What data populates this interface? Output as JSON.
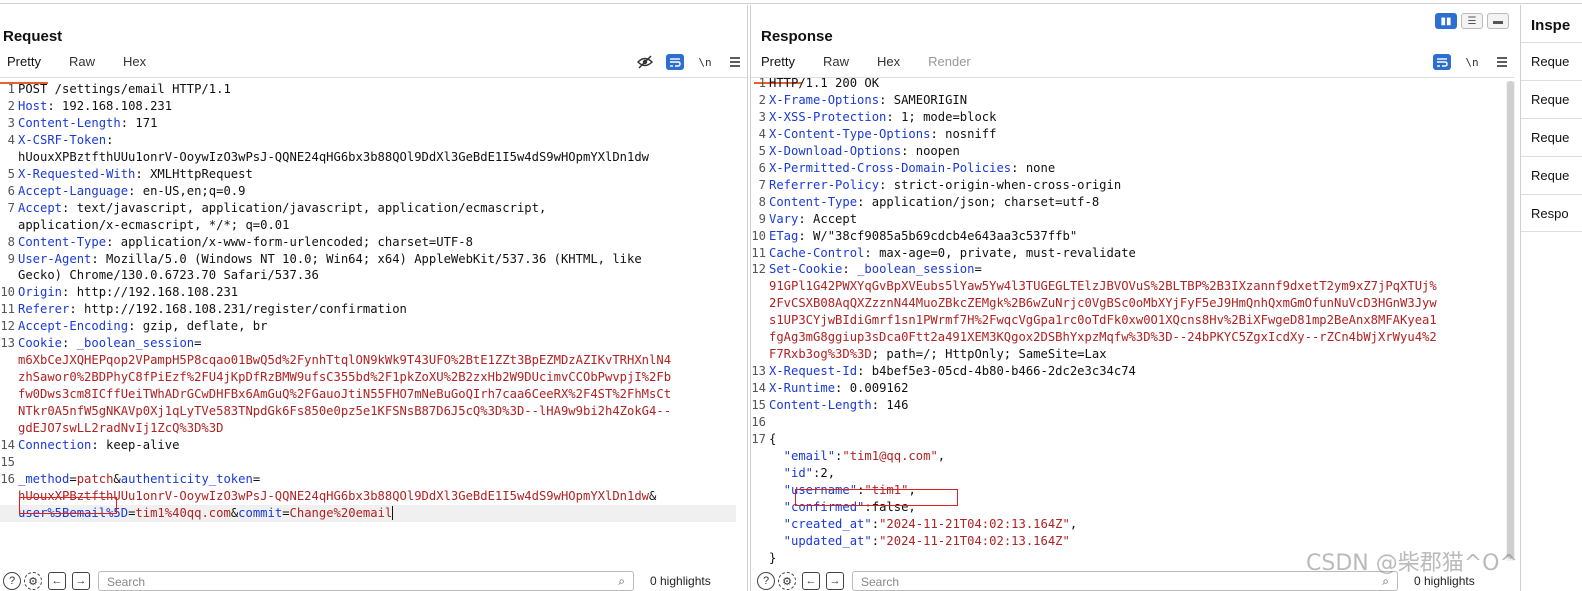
{
  "request": {
    "title": "Request",
    "tabs": [
      "Pretty",
      "Raw",
      "Hex"
    ],
    "lines": [
      {
        "n": "1",
        "parts": [
          {
            "t": "POST /settings/email HTTP/1.1",
            "c": "v"
          }
        ]
      },
      {
        "n": "2",
        "parts": [
          {
            "t": "Host",
            "c": "k"
          },
          {
            "t": ": 192.168.108.231",
            "c": "v"
          }
        ]
      },
      {
        "n": "3",
        "parts": [
          {
            "t": "Content-Length",
            "c": "k"
          },
          {
            "t": ": 171",
            "c": "v"
          }
        ]
      },
      {
        "n": "4",
        "parts": [
          {
            "t": "X-CSRF-Token",
            "c": "k"
          },
          {
            "t": ":",
            "c": "v"
          }
        ]
      },
      {
        "n": "",
        "parts": [
          {
            "t": "hUouxXPBztfthUUu1onrV-OoywIzO3wPsJ-QQNE24qHG6bx3b88QOl9DdXl3GeBdE1I5w4dS9wHOpmYXlDn1dw",
            "c": "v"
          }
        ]
      },
      {
        "n": "5",
        "parts": [
          {
            "t": "X-Requested-With",
            "c": "k"
          },
          {
            "t": ": XMLHttpRequest",
            "c": "v"
          }
        ]
      },
      {
        "n": "6",
        "parts": [
          {
            "t": "Accept-Language",
            "c": "k"
          },
          {
            "t": ": en-US,en;q=0.9",
            "c": "v"
          }
        ]
      },
      {
        "n": "7",
        "parts": [
          {
            "t": "Accept",
            "c": "k"
          },
          {
            "t": ": text/javascript, application/javascript, application/ecmascript,",
            "c": "v"
          }
        ]
      },
      {
        "n": "",
        "parts": [
          {
            "t": "application/x-ecmascript, */*; q=0.01",
            "c": "v"
          }
        ]
      },
      {
        "n": "8",
        "parts": [
          {
            "t": "Content-Type",
            "c": "k"
          },
          {
            "t": ": application/x-www-form-urlencoded; charset=UTF-8",
            "c": "v"
          }
        ]
      },
      {
        "n": "9",
        "parts": [
          {
            "t": "User-Agent",
            "c": "k"
          },
          {
            "t": ": Mozilla/5.0 (Windows NT 10.0; Win64; x64) AppleWebKit/537.36 (KHTML, like",
            "c": "v"
          }
        ]
      },
      {
        "n": "",
        "parts": [
          {
            "t": "Gecko) Chrome/130.0.6723.70 Safari/537.36",
            "c": "v"
          }
        ]
      },
      {
        "n": "10",
        "parts": [
          {
            "t": "Origin",
            "c": "k"
          },
          {
            "t": ": http://192.168.108.231",
            "c": "v"
          }
        ]
      },
      {
        "n": "11",
        "parts": [
          {
            "t": "Referer",
            "c": "k"
          },
          {
            "t": ": http://192.168.108.231/register/confirmation",
            "c": "v"
          }
        ]
      },
      {
        "n": "12",
        "parts": [
          {
            "t": "Accept-Encoding",
            "c": "k"
          },
          {
            "t": ": gzip, deflate, br",
            "c": "v"
          }
        ]
      },
      {
        "n": "13",
        "parts": [
          {
            "t": "Cookie",
            "c": "k"
          },
          {
            "t": ": ",
            "c": "v"
          },
          {
            "t": "_boolean_session",
            "c": "k"
          },
          {
            "t": "=",
            "c": "v"
          }
        ]
      },
      {
        "n": "",
        "parts": [
          {
            "t": "m6XbCeJXQHEPqop2VPampH5P8cqao01BwQ5d%2FynhTtqlON9kWk9T43UFO%2BtE1ZZt3BpEZMDzAZIKvTRHXnlN4",
            "c": "r"
          }
        ]
      },
      {
        "n": "",
        "parts": [
          {
            "t": "zhSawor0%2BDPhyC8fPiEzf%2FU4jKpDfRzBMW9ufsC355bd%2F1pkZoXU%2B2zxHb2W9DUcimvCCObPwvpjI%2Fb",
            "c": "r"
          }
        ]
      },
      {
        "n": "",
        "parts": [
          {
            "t": "fw0Dws3cm8ICffUeiTWhADrGCwDHFBx6AmGuQ%2FGauoJtiN55FHO7mNeBuGoQIrh7caa6CeeRX%2F4ST%2FhMsCt",
            "c": "r"
          }
        ]
      },
      {
        "n": "",
        "parts": [
          {
            "t": "NTkr0A5nfW5gNKAVp0Xj1qLyTVe583TNpdGk6Fs850e0pz5e1KFSNsB87D6J5cQ%3D%3D--lHA9w9bi2h4ZokG4--",
            "c": "r"
          }
        ]
      },
      {
        "n": "",
        "parts": [
          {
            "t": "gdEJO7swLL2radNvIj1ZcQ%3D%3D",
            "c": "r"
          }
        ]
      },
      {
        "n": "14",
        "parts": [
          {
            "t": "Connection",
            "c": "k"
          },
          {
            "t": ": keep-alive",
            "c": "v"
          }
        ]
      },
      {
        "n": "15",
        "parts": [
          {
            "t": "",
            "c": "v"
          }
        ]
      },
      {
        "n": "16",
        "parts": [
          {
            "t": "_method",
            "c": "k"
          },
          {
            "t": "=",
            "c": "v"
          },
          {
            "t": "patch",
            "c": "r"
          },
          {
            "t": "&",
            "c": "v"
          },
          {
            "t": "authenticity_token",
            "c": "k"
          },
          {
            "t": "=",
            "c": "v"
          }
        ]
      },
      {
        "n": "",
        "parts": [
          {
            "t": "hUouxXPBztfthUUu1onrV-OoywIzO3wPsJ-QQNE24qHG6bx3b88QOl9DdXl3GeBdE1I5w4dS9wHOpmYXlDn1dw",
            "c": "r"
          },
          {
            "t": "&",
            "c": "v"
          }
        ]
      },
      {
        "n": "",
        "cur": true,
        "parts": [
          {
            "t": "user%5Bemail",
            "c": "k"
          },
          {
            "t": "%5D",
            "c": "k"
          },
          {
            "t": "=",
            "c": "v"
          },
          {
            "t": "tim1%40qq.com",
            "c": "r"
          },
          {
            "t": "&",
            "c": "v"
          },
          {
            "t": "commit",
            "c": "k"
          },
          {
            "t": "=",
            "c": "v"
          },
          {
            "t": "Change%20email",
            "c": "r"
          }
        ]
      }
    ],
    "search_placeholder": "Search",
    "highlights": "0 highlights"
  },
  "response": {
    "title": "Response",
    "tabs": [
      "Pretty",
      "Raw",
      "Hex",
      "Render"
    ],
    "lines": [
      {
        "n": "1",
        "parts": [
          {
            "t": "HTTP/1.1 200 OK",
            "c": "v"
          }
        ]
      },
      {
        "n": "2",
        "parts": [
          {
            "t": "X-Frame-Options",
            "c": "k"
          },
          {
            "t": ": SAMEORIGIN",
            "c": "v"
          }
        ]
      },
      {
        "n": "3",
        "parts": [
          {
            "t": "X-XSS-Protection",
            "c": "k"
          },
          {
            "t": ": 1; mode=block",
            "c": "v"
          }
        ]
      },
      {
        "n": "4",
        "parts": [
          {
            "t": "X-Content-Type-Options",
            "c": "k"
          },
          {
            "t": ": nosniff",
            "c": "v"
          }
        ]
      },
      {
        "n": "5",
        "parts": [
          {
            "t": "X-Download-Options",
            "c": "k"
          },
          {
            "t": ": noopen",
            "c": "v"
          }
        ]
      },
      {
        "n": "6",
        "parts": [
          {
            "t": "X-Permitted-Cross-Domain-Policies",
            "c": "k"
          },
          {
            "t": ": none",
            "c": "v"
          }
        ]
      },
      {
        "n": "7",
        "parts": [
          {
            "t": "Referrer-Policy",
            "c": "k"
          },
          {
            "t": ": strict-origin-when-cross-origin",
            "c": "v"
          }
        ]
      },
      {
        "n": "8",
        "parts": [
          {
            "t": "Content-Type",
            "c": "k"
          },
          {
            "t": ": application/json; charset=utf-8",
            "c": "v"
          }
        ]
      },
      {
        "n": "9",
        "parts": [
          {
            "t": "Vary",
            "c": "k"
          },
          {
            "t": ": Accept",
            "c": "v"
          }
        ]
      },
      {
        "n": "10",
        "parts": [
          {
            "t": "ETag",
            "c": "k"
          },
          {
            "t": ": W/\"38cf9085a5b69cdcb4e643aa3c537ffb\"",
            "c": "v"
          }
        ]
      },
      {
        "n": "11",
        "parts": [
          {
            "t": "Cache-Control",
            "c": "k"
          },
          {
            "t": ": max-age=0, private, must-revalidate",
            "c": "v"
          }
        ]
      },
      {
        "n": "12",
        "parts": [
          {
            "t": "Set-Cookie",
            "c": "k"
          },
          {
            "t": ": ",
            "c": "v"
          },
          {
            "t": "_boolean_session",
            "c": "k"
          },
          {
            "t": "=",
            "c": "v"
          }
        ]
      },
      {
        "n": "",
        "parts": [
          {
            "t": "91GPl1G42PWXYqGvBpXVEubs5lYaw5Yw4l3TUGEGLTElzJBVOVuS%2BLTBP%2B3IXzannf9dxetT2ym9xZ7jPqXTUj%",
            "c": "r"
          }
        ]
      },
      {
        "n": "",
        "parts": [
          {
            "t": "2FvCSXB08AqQXZzznN44MuoZBkcZEMgk%2B6wZuNrjc0VgBSc0oMbXYjFyF5eJ9HmQnhQxmGmOfunNuVcD3HGnW3Jyw",
            "c": "r"
          }
        ]
      },
      {
        "n": "",
        "parts": [
          {
            "t": "s1UP3CYjwBIdiGmrf1sn1PWrmf7H%2FwqcVgGpa1rc0oTdFk0xw0O1XQcns8Hv%2BiXFwgeD81mp2BeAnx8MFAKyea1",
            "c": "r"
          }
        ]
      },
      {
        "n": "",
        "parts": [
          {
            "t": "fgAg3mG8ggiup3sDca0Ftt2a491XEM3KQgox2DSBhYxpzMqfw%3D%3D--24bPKYC5ZgxIcdXy--rZCn4bWjXrWyu4%2",
            "c": "r"
          }
        ]
      },
      {
        "n": "",
        "parts": [
          {
            "t": "F7Rxb3og%3D%3D",
            "c": "r"
          },
          {
            "t": "; path=/; HttpOnly; SameSite=Lax",
            "c": "v"
          }
        ]
      },
      {
        "n": "13",
        "parts": [
          {
            "t": "X-Request-Id",
            "c": "k"
          },
          {
            "t": ": b4bef5e3-05cd-4b80-b466-2dc2e3c34c74",
            "c": "v"
          }
        ]
      },
      {
        "n": "14",
        "parts": [
          {
            "t": "X-Runtime",
            "c": "k"
          },
          {
            "t": ": 0.009162",
            "c": "v"
          }
        ]
      },
      {
        "n": "15",
        "parts": [
          {
            "t": "Content-Length",
            "c": "k"
          },
          {
            "t": ": 146",
            "c": "v"
          }
        ]
      },
      {
        "n": "16",
        "parts": [
          {
            "t": "",
            "c": "v"
          }
        ]
      },
      {
        "n": "17",
        "parts": [
          {
            "t": "{",
            "c": "v"
          }
        ]
      },
      {
        "n": "",
        "parts": [
          {
            "t": "  \"email\"",
            "c": "k"
          },
          {
            "t": ":",
            "c": "v"
          },
          {
            "t": "\"tim1@qq.com\"",
            "c": "r"
          },
          {
            "t": ",",
            "c": "v"
          }
        ]
      },
      {
        "n": "",
        "parts": [
          {
            "t": "  \"id\"",
            "c": "k"
          },
          {
            "t": ":2,",
            "c": "v"
          }
        ]
      },
      {
        "n": "",
        "parts": [
          {
            "t": "  \"username\"",
            "c": "k"
          },
          {
            "t": ":",
            "c": "v"
          },
          {
            "t": "\"tim1\"",
            "c": "r"
          },
          {
            "t": ",",
            "c": "v"
          }
        ]
      },
      {
        "n": "",
        "parts": [
          {
            "t": "  \"confirmed\"",
            "c": "k"
          },
          {
            "t": ":false,",
            "c": "v"
          }
        ]
      },
      {
        "n": "",
        "parts": [
          {
            "t": "  \"created_at\"",
            "c": "k"
          },
          {
            "t": ":",
            "c": "v"
          },
          {
            "t": "\"2024-11-21T04:02:13.164Z\"",
            "c": "r"
          },
          {
            "t": ",",
            "c": "v"
          }
        ]
      },
      {
        "n": "",
        "parts": [
          {
            "t": "  \"updated_at\"",
            "c": "k"
          },
          {
            "t": ":",
            "c": "v"
          },
          {
            "t": "\"2024-11-21T04:02:13.164Z\"",
            "c": "r"
          }
        ]
      },
      {
        "n": "",
        "parts": [
          {
            "t": "}",
            "c": "v"
          }
        ]
      }
    ],
    "search_placeholder": "Search",
    "highlights": "0 highlights"
  },
  "inspector": {
    "title": "Inspe",
    "items": [
      "Reque",
      "Reque",
      "Reque",
      "Reque",
      "Respo"
    ]
  },
  "icons": {
    "hide": "eye-slash-icon",
    "wrap": "wrap-icon",
    "newline": "\\n",
    "menu": "menu-icon"
  },
  "watermark": "CSDN @柴郡猫^O^",
  "colors": {
    "key": "#1a3ad8",
    "value": "#b22222",
    "accent": "#e8602c",
    "button": "#2c6fd1"
  }
}
